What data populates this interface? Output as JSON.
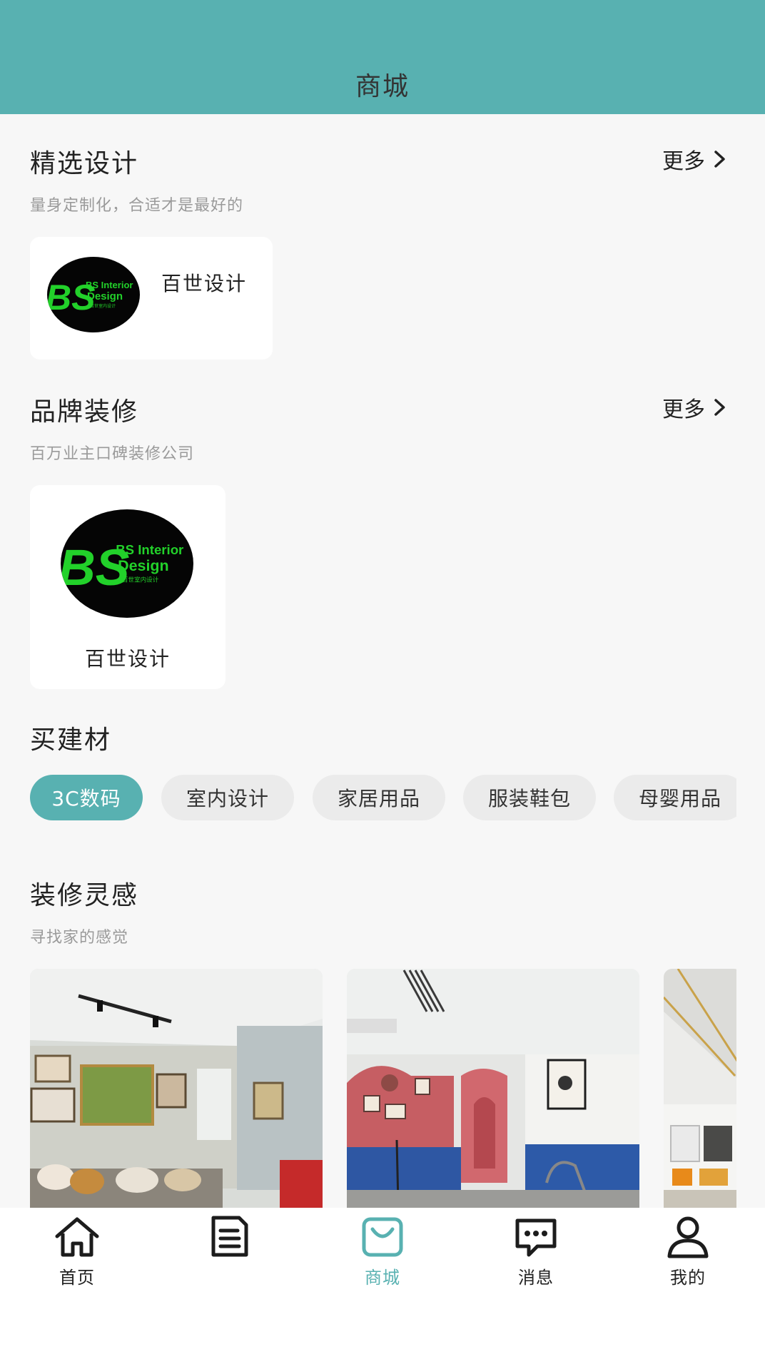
{
  "header": {
    "title": "商城"
  },
  "featured": {
    "title": "精选设计",
    "subtitle": "量身定制化，合适才是最好的",
    "more_label": "更多",
    "card": {
      "name": "百世设计"
    }
  },
  "brand": {
    "title": "品牌装修",
    "subtitle": "百万业主口碑装修公司",
    "more_label": "更多",
    "card": {
      "name": "百世设计"
    }
  },
  "logo": {
    "big_letters": "BS",
    "line1": "BS Interior",
    "line2": "Design",
    "line3": "百世室内设计"
  },
  "materials": {
    "title": "买建材",
    "chips": [
      {
        "label": "3C数码",
        "active": true
      },
      {
        "label": "室内设计",
        "active": false
      },
      {
        "label": "家居用品",
        "active": false
      },
      {
        "label": "服装鞋包",
        "active": false
      },
      {
        "label": "母婴用品",
        "active": false
      }
    ]
  },
  "inspiration": {
    "title": "装修灵感",
    "subtitle": "寻找家的感觉"
  },
  "tabbar": {
    "items": [
      {
        "label": "首页",
        "icon": "home-icon"
      },
      {
        "label": "",
        "icon": "document-icon"
      },
      {
        "label": "商城",
        "icon": "shopping-bag-icon",
        "active": true
      },
      {
        "label": "消息",
        "icon": "chat-icon"
      },
      {
        "label": "我的",
        "icon": "user-icon"
      }
    ]
  },
  "colors": {
    "accent": "#58b1b1",
    "background": "#f7f7f7",
    "chip": "#ebebeb"
  }
}
